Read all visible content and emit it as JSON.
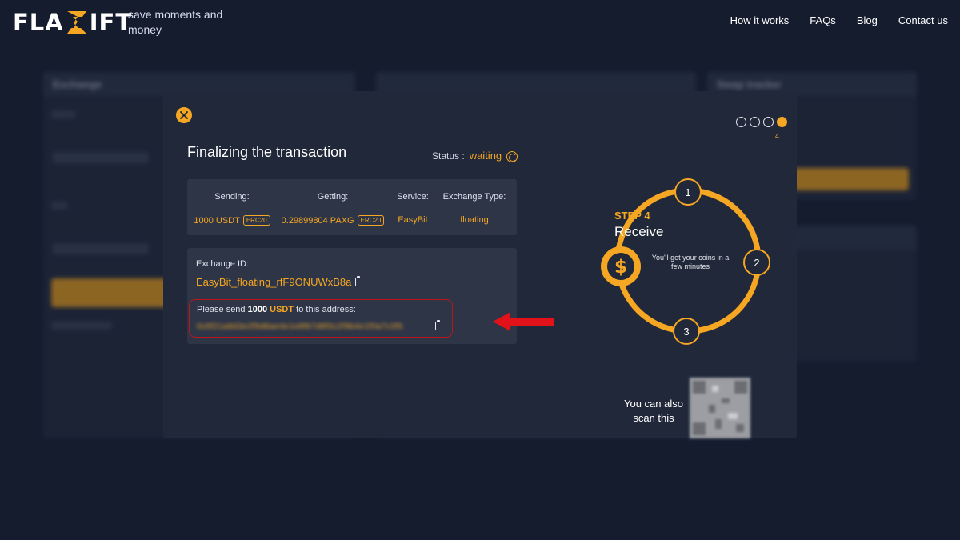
{
  "header": {
    "logo_left": "FLA",
    "logo_right": "IFT",
    "tagline": "save moments and money",
    "nav": [
      "How it works",
      "FAQs",
      "Blog",
      "Contact us"
    ]
  },
  "background": {
    "exchange_title": "Exchange",
    "from_label": "From",
    "to_label": "To",
    "fixed_rate": "Fixed Rate",
    "floating_rate": "Floating Rate",
    "swap_tracker": "Swap tracker"
  },
  "modal": {
    "title": "Finalizing the transaction",
    "status_label": "Status :",
    "status_value": "waiting",
    "info": {
      "sending_label": "Sending:",
      "sending_value": "1000 USDT",
      "sending_network": "ERC20",
      "getting_label": "Getting:",
      "getting_value": "0.29899804 PAXG",
      "getting_network": "ERC20",
      "service_label": "Service:",
      "service_value": "EasyBit",
      "type_label": "Exchange Type:",
      "type_value": "floating"
    },
    "exchange_id_label": "Exchange ID:",
    "exchange_id_value": "EasyBit_floating_rfF9ONUWxB8a",
    "send_prefix": "Please send",
    "send_amount": "1000",
    "send_coin": "USDT",
    "send_suffix": "to this address:",
    "address": "0x9f21a8d3e2f9d8ae4e1e8fb7d8f0c2f9b4e1f0a7c3f6",
    "steps": {
      "current": 4,
      "total": 4,
      "current_label": "4",
      "step_label": "STEP 4",
      "step_title": "Receive",
      "step_desc": "You'll get your coins in a few minutes",
      "markers": [
        "1",
        "2",
        "3"
      ]
    },
    "scan_text": "You can also scan this"
  },
  "colors": {
    "accent": "#f5a623",
    "background": "#141c2e",
    "modal": "#202839",
    "card": "#2d3547",
    "highlight_border": "#c0141c",
    "arrow": "#e2121a"
  }
}
